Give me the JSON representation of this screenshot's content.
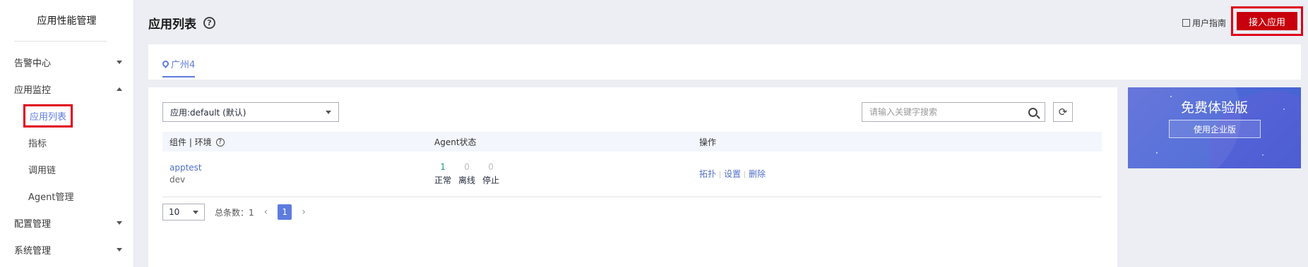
{
  "sidebar": {
    "title": "应用性能管理",
    "items": [
      {
        "label": "告警中心",
        "expanded": false
      },
      {
        "label": "应用监控",
        "expanded": true,
        "children": [
          {
            "label": "应用列表",
            "active": true
          },
          {
            "label": "指标"
          },
          {
            "label": "调用链"
          },
          {
            "label": "Agent管理"
          }
        ]
      },
      {
        "label": "配置管理",
        "expanded": false
      },
      {
        "label": "系统管理",
        "expanded": false
      }
    ]
  },
  "header": {
    "title": "应用列表",
    "help_glyph": "?",
    "guide_label": "用户指南",
    "connect_label": "接入应用"
  },
  "region": {
    "label": "广州4"
  },
  "toolbar": {
    "app_select_value": "应用:default (默认)",
    "search_placeholder": "请输入关键字搜索",
    "refresh_glyph": "⟳"
  },
  "table": {
    "columns": [
      "组件 | 环境",
      "Agent状态",
      "操作"
    ],
    "rows": [
      {
        "component": "apptest",
        "env": "dev",
        "status": {
          "normal": "1",
          "normal_label": "正常",
          "offline": "0",
          "offline_label": "离线",
          "stopped": "0",
          "stopped_label": "停止"
        },
        "actions": [
          "拓扑",
          "设置",
          "删除"
        ]
      }
    ]
  },
  "pagination": {
    "page_size": "10",
    "total_label": "总条数：1",
    "current_page": "1"
  },
  "promo": {
    "title": "免费体验版",
    "button_label": "使用企业版"
  },
  "colors": {
    "accent": "#5e7ce0",
    "primary_button": "#c7000b",
    "highlight_box": "#e0001b",
    "status_ok": "#1a9e72"
  }
}
